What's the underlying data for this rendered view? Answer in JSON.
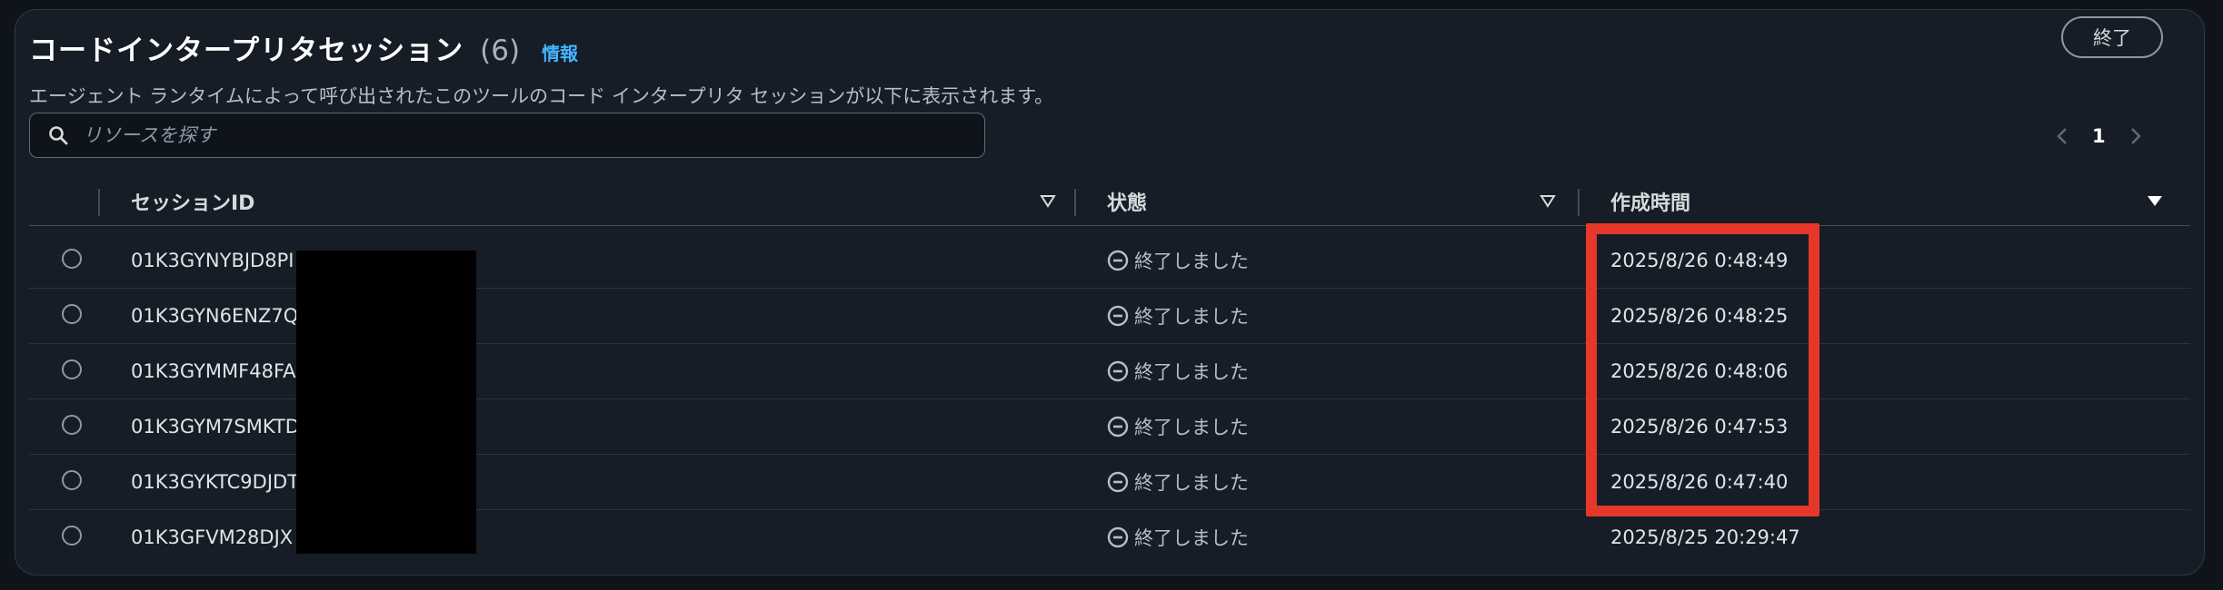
{
  "header": {
    "title": "コードインタープリタセッション",
    "count": "(6)",
    "info_link": "情報",
    "description": "エージェント ランタイムによって呼び出されたこのツールのコード インタープリタ セッションが以下に表示されます。",
    "end_button": "終了"
  },
  "search": {
    "placeholder": "リソースを探す",
    "icon": "search-icon"
  },
  "pagination": {
    "current_page": "1",
    "prev_icon": "chevron-left-icon",
    "next_icon": "chevron-right-icon"
  },
  "table": {
    "columns": [
      "セッションID",
      "状態",
      "作成時間"
    ],
    "rows": [
      {
        "session_id": "01K3GYNYBJD8PI",
        "status": "終了しました",
        "created": "2025/8/26 0:48:49"
      },
      {
        "session_id": "01K3GYN6ENZ7Q",
        "status": "終了しました",
        "created": "2025/8/26 0:48:25"
      },
      {
        "session_id": "01K3GYMMF48FA",
        "status": "終了しました",
        "created": "2025/8/26 0:48:06"
      },
      {
        "session_id": "01K3GYM7SMKTD",
        "status": "終了しました",
        "created": "2025/8/26 0:47:53"
      },
      {
        "session_id": "01K3GYKTC9DJDT",
        "status": "終了しました",
        "created": "2025/8/26 0:47:40"
      },
      {
        "session_id": "01K3GFVM28DJX",
        "status": "終了しました",
        "created": "2025/8/25 20:29:47"
      }
    ]
  },
  "colors": {
    "background": "#0f141b",
    "panel": "#161d26",
    "link": "#42b4ff",
    "highlight": "#e6382a"
  }
}
